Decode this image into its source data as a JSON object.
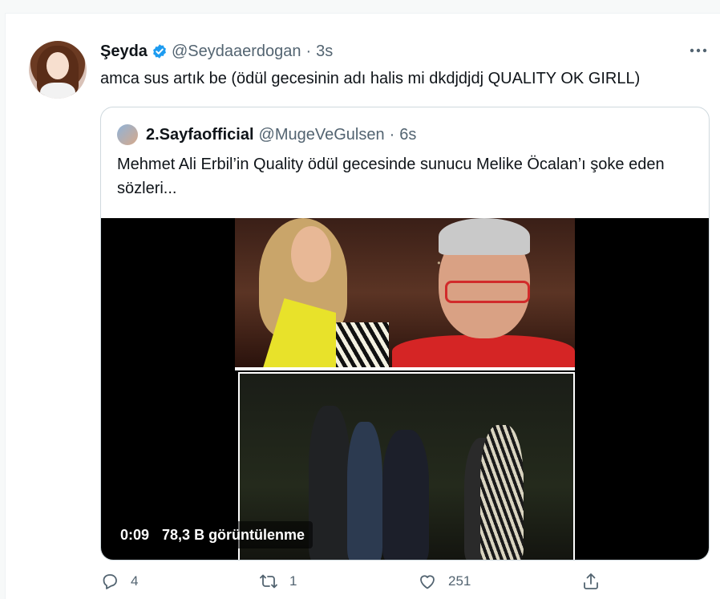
{
  "tweet": {
    "author_name": "Şeyda",
    "handle": "@Seydaaerdogan",
    "separator": "·",
    "time": "3s",
    "text": "amca sus artık be (ödül gecesinin adı halis mi dkdjdjdj QUALITY OK GIRLL)",
    "more_icon": "more-icon",
    "verified_icon": "verified-badge-icon",
    "accent_color": "#1d9bf0"
  },
  "quoted": {
    "author_name": "2.Sayfaofficial",
    "handle": "@MugeVeGulsen",
    "separator": "·",
    "time": "6s",
    "text": "Mehmet Ali Erbil’in Quality ödül gecesinde sunucu Melike Öcalan’ı şoke eden sözleri...",
    "video": {
      "duration": "0:09",
      "views": "78,3 B görüntülenme"
    }
  },
  "actions": {
    "reply_count": "4",
    "retweet_count": "1",
    "like_count": "251",
    "reply_icon": "reply-icon",
    "retweet_icon": "retweet-icon",
    "like_icon": "heart-icon",
    "share_icon": "share-icon"
  }
}
